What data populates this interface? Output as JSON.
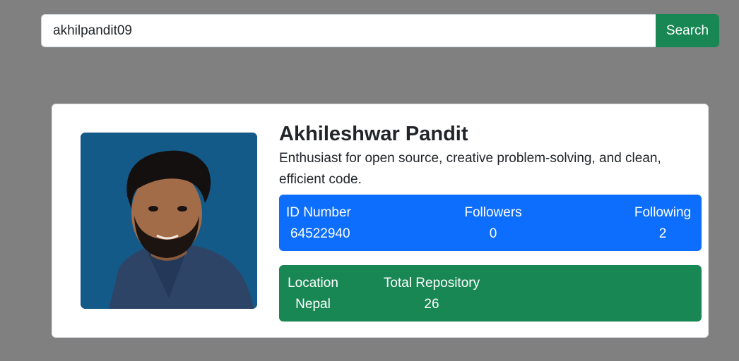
{
  "search": {
    "value": "akhilpandit09",
    "button_label": "Search"
  },
  "profile": {
    "avatar_icon": "user-photo",
    "name": "Akhileshwar Pandit",
    "bio": "Enthusiast for open source, creative problem-solving, and clean, efficient code."
  },
  "stats_primary": {
    "id_label": "ID Number",
    "id_value": "64522940",
    "followers_label": "Followers",
    "followers_value": "0",
    "following_label": "Following",
    "following_value": "2"
  },
  "stats_secondary": {
    "location_label": "Location",
    "location_value": "Nepal",
    "repos_label": "Total Repository",
    "repos_value": "26"
  },
  "colors": {
    "background": "#808080",
    "search_button": "#198754",
    "stats_primary_bg": "#0d6efd",
    "stats_secondary_bg": "#198754",
    "avatar_bg": "#145a89"
  }
}
